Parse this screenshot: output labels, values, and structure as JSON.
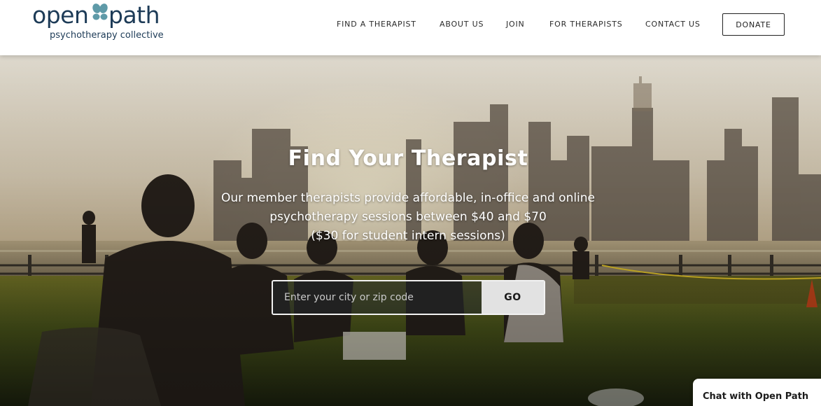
{
  "logo": {
    "word_left": "open",
    "word_right": "path",
    "tagline": "psychotherapy collective"
  },
  "nav": {
    "items": [
      "FIND A THERAPIST",
      "ABOUT US",
      "JOIN",
      "FOR THERAPISTS",
      "CONTACT US"
    ],
    "donate_label": "DONATE"
  },
  "hero": {
    "title": "Find Your Therapist",
    "description_lines": [
      "Our member therapists provide affordable, in-office and online",
      "psychotherapy sessions between $40 and $70",
      "($30 for student intern sessions)"
    ]
  },
  "search": {
    "placeholder": "Enter your city or zip code",
    "button_label": "GO"
  },
  "chat": {
    "label": "Chat with Open Path"
  },
  "colors": {
    "brand_navy": "#1d3b57",
    "brand_teal": "#5e9aa8"
  }
}
